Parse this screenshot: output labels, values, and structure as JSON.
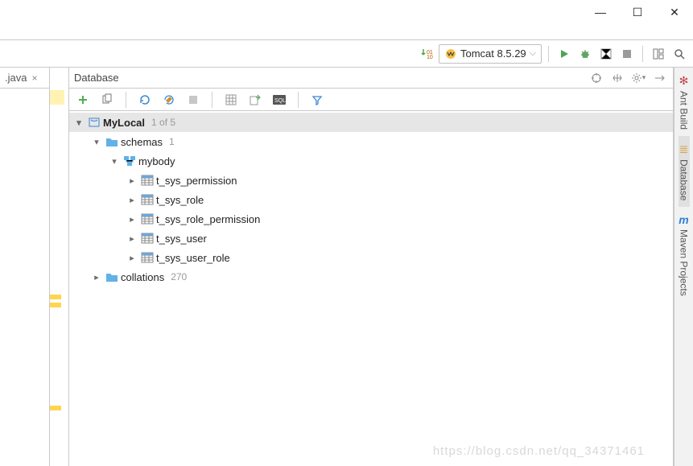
{
  "window": {
    "minimize_glyph": "—",
    "maximize_glyph": "☐",
    "close_glyph": "✕"
  },
  "top_toolbar": {
    "download_icon": "download-small-icon",
    "run_config": {
      "icon": "tomcat-icon",
      "label": "Tomcat 8.5.29",
      "dropdown_glyph": "⌵"
    },
    "run_icon": "play-icon",
    "debug_icon": "bug-icon",
    "coverage_icon": "coverage-icon",
    "stop_icon": "stop-icon",
    "update_icon": "layout-icon",
    "search_icon": "search-icon"
  },
  "editor_tab": {
    "label": ".java",
    "close_glyph": "×"
  },
  "db_panel": {
    "title": "Database",
    "header_icons": {
      "add_target": "target-icon",
      "split": "split-icon",
      "gear": "gear-icon",
      "collapse": "collapse-icon"
    },
    "toolbar": {
      "add": "plus-icon",
      "duplicate": "copy-icon",
      "refresh": "refresh-icon",
      "sync": "wrench-refresh-icon",
      "stop": "stop-small-icon",
      "table": "table-view-icon",
      "export": "export-icon",
      "console": "sql-console-icon",
      "filter": "filter-icon"
    },
    "tree": {
      "root": {
        "label": "MyLocal",
        "count": "1 of 5",
        "icon": "database-connection-icon"
      },
      "schemas": {
        "label": "schemas",
        "count": "1",
        "icon": "folder-icon"
      },
      "schema_db": {
        "label": "mybody",
        "icon": "schema-icon"
      },
      "tables": [
        {
          "label": "t_sys_permission",
          "icon": "table-icon"
        },
        {
          "label": "t_sys_role",
          "icon": "table-icon"
        },
        {
          "label": "t_sys_role_permission",
          "icon": "table-icon"
        },
        {
          "label": "t_sys_user",
          "icon": "table-icon"
        },
        {
          "label": "t_sys_user_role",
          "icon": "table-icon"
        }
      ],
      "collations": {
        "label": "collations",
        "count": "270",
        "icon": "folder-icon"
      }
    }
  },
  "right_strip": {
    "ant": {
      "label": "Ant Build",
      "icon": "ant-icon"
    },
    "database": {
      "label": "Database",
      "icon": "db-cylinder-icon"
    },
    "maven": {
      "label": "Maven Projects",
      "icon": "maven-m-icon"
    }
  },
  "watermark": "https://blog.csdn.net/qq_34371461",
  "colors": {
    "accent_green": "#4caf50",
    "accent_blue": "#3a87d6",
    "folder": "#62b1e8",
    "run_green": "#49a74f",
    "debug_green": "#5fa45f",
    "stop_gray": "#9a9a9a"
  }
}
